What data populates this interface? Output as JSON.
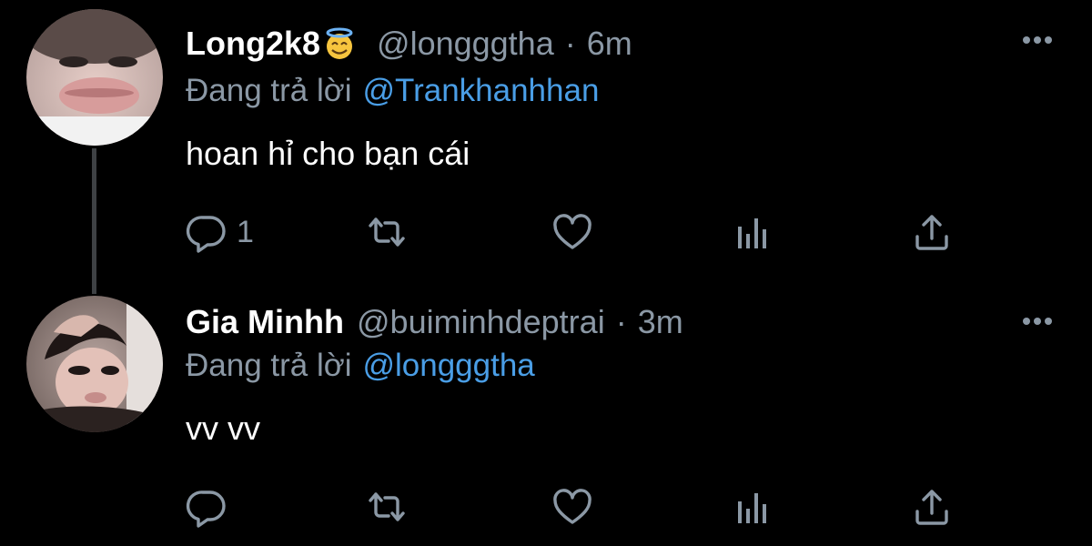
{
  "colors": {
    "background": "#000000",
    "name": "#ffffff",
    "muted": "#8b98a5",
    "mention": "#4a9ee6",
    "thread_line": "#3e4144"
  },
  "tweets": [
    {
      "display_name": "Long2k8",
      "emoji": "smiling-face-with-halo-emoji",
      "handle": "@longggtha",
      "separator": "·",
      "time": "6m",
      "reply_prefix": "Đang trả lời",
      "reply_to": "@Trankhanhhan",
      "text": "hoan hỉ cho bạn cái",
      "reply_count": "1",
      "icons": [
        "reply-icon",
        "retweet-icon",
        "like-icon",
        "views-icon",
        "share-icon",
        "more-icon"
      ]
    },
    {
      "display_name": "Gia Minhh",
      "handle": "@buiminhdeptrai",
      "separator": "·",
      "time": "3m",
      "reply_prefix": "Đang trả lời",
      "reply_to": "@longggtha",
      "text": "vv vv",
      "reply_count": "",
      "icons": [
        "reply-icon",
        "retweet-icon",
        "like-icon",
        "views-icon",
        "share-icon",
        "more-icon"
      ]
    }
  ]
}
